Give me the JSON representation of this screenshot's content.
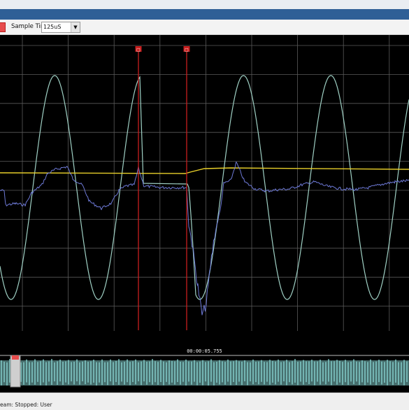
{
  "toolbar": {
    "sample_time_label": "Sample Time:",
    "sample_time_value": "125uS",
    "dropdown_icon": "chevron-down-icon"
  },
  "scope": {
    "cursor_1_label": "□",
    "cursor_2_label": "□",
    "colors": {
      "background": "#000000",
      "grid": "#5a5a5a",
      "sine_trace": "#9fd0c4",
      "yellow_trace": "#e8cf2a",
      "blue_trace": "#6d79d6",
      "cursor": "#c81e1e"
    }
  },
  "navigator": {
    "timestamp": "00:00:05.755",
    "colors": {
      "wave": "#7fc7c4"
    }
  },
  "status": {
    "text": "eam:  Stopped: User"
  }
}
